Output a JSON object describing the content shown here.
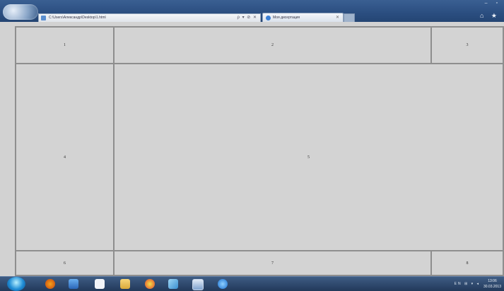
{
  "browser": {
    "address": "C:\\Users\\Александр\\Desktop\\1.html",
    "address_controls": "ρ ▾ ⊘ ✕",
    "tab_title": "Моя дисертация",
    "tab_close": "✕",
    "window_controls": "– ▫",
    "toolbar_icons": "⌂ ★"
  },
  "grid": {
    "cell_1": "1",
    "cell_2": "2",
    "cell_3": "3",
    "cell_4": "4",
    "cell_5": "5",
    "cell_6": "6",
    "cell_7": "7",
    "cell_8": "8"
  },
  "taskbar": {
    "icons": [
      "firefox-icon",
      "media-icon",
      "player-icon",
      "folder-icon",
      "chrome-icon",
      "paint-icon",
      "monitor-icon",
      "ie-icon"
    ],
    "tray": "EN ⊞ ▾ ◂",
    "clock_time": "13:06",
    "clock_date": "30.03.2013"
  },
  "colors": {
    "page_bg": "#d3d3d3",
    "cell_border": "#8e8e8e",
    "taskbar": "#2d4a70"
  }
}
